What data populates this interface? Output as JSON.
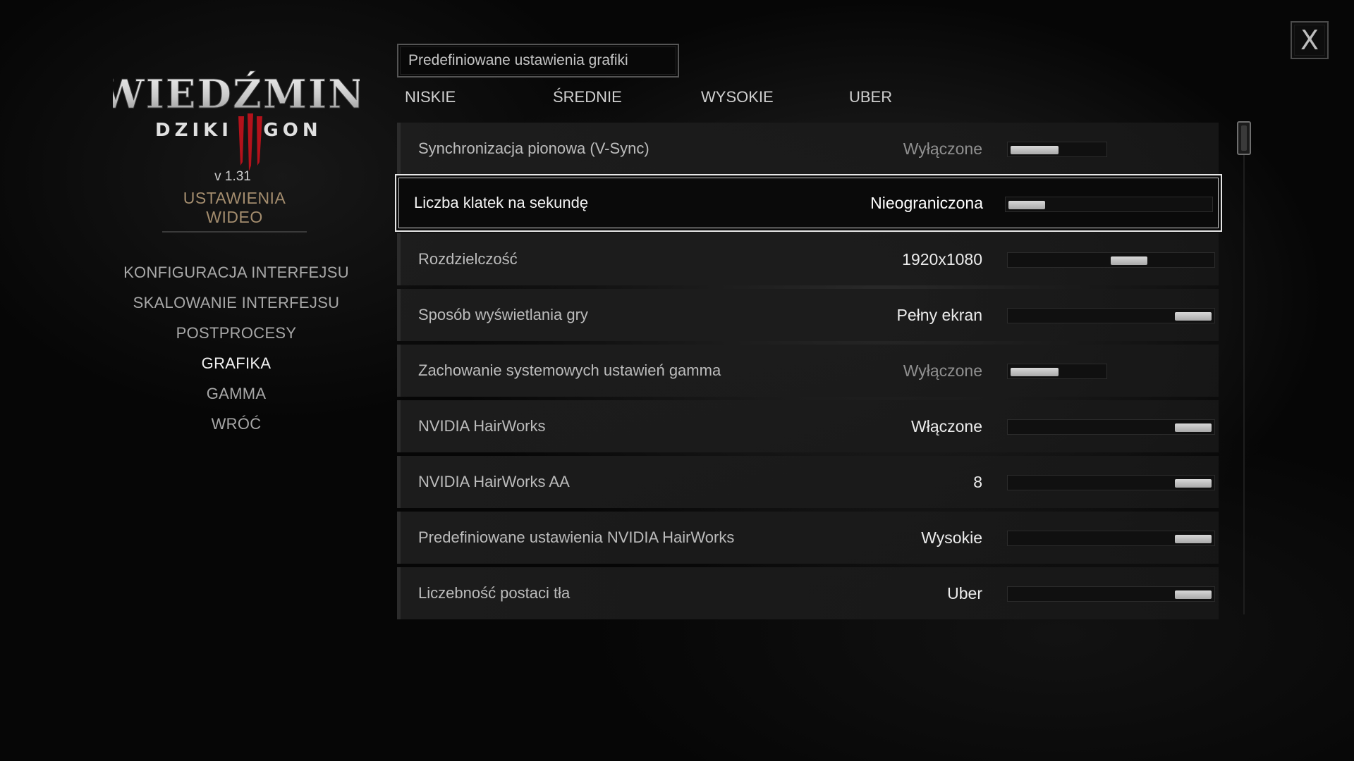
{
  "close_button": {
    "label": "X"
  },
  "logo": {
    "title": "WIEDŹMIN",
    "subtitle_left": "DZIKI",
    "subtitle_right": "GON",
    "numeral": "III"
  },
  "sidebar": {
    "version": "v 1.31",
    "section_title": "USTAWIENIA WIDEO",
    "items": [
      {
        "label": "KONFIGURACJA INTERFEJSU",
        "active": false
      },
      {
        "label": "SKALOWANIE INTERFEJSU",
        "active": false
      },
      {
        "label": "POSTPROCESY",
        "active": false
      },
      {
        "label": "GRAFIKA",
        "active": true
      },
      {
        "label": "GAMMA",
        "active": false
      },
      {
        "label": "WRÓĆ",
        "active": false
      }
    ]
  },
  "presets": {
    "title": "Predefiniowane ustawienia grafiki",
    "options": [
      "NISKIE",
      "ŚREDNIE",
      "WYSOKIE",
      "UBER"
    ]
  },
  "settings": [
    {
      "label": "Synchronizacja pionowa (V-Sync)",
      "value": "Wyłączone",
      "slider_type": "toggle",
      "level": 0.0,
      "dim": true
    },
    {
      "label": "Liczba klatek na sekundę",
      "value": "Nieograniczona",
      "slider_type": "range",
      "level": 0.0,
      "selected": true
    },
    {
      "label": "Rozdzielczość",
      "value": "1920x1080",
      "slider_type": "range",
      "level": 0.55
    },
    {
      "label": "Sposób wyświetlania gry",
      "value": "Pełny ekran",
      "slider_type": "range",
      "level": 1.0
    },
    {
      "label": "Zachowanie systemowych ustawień gamma",
      "value": "Wyłączone",
      "slider_type": "toggle",
      "level": 0.0,
      "dim": true
    },
    {
      "label": "NVIDIA HairWorks",
      "value": "Włączone",
      "slider_type": "range",
      "level": 1.0
    },
    {
      "label": "NVIDIA HairWorks AA",
      "value": "8",
      "slider_type": "range",
      "level": 1.0
    },
    {
      "label": "Predefiniowane ustawienia NVIDIA HairWorks",
      "value": "Wysokie",
      "slider_type": "range",
      "level": 1.0
    },
    {
      "label": "Liczebność postaci tła",
      "value": "Uber",
      "slider_type": "range",
      "level": 1.0
    }
  ],
  "colors": {
    "accent_title": "#a48d6e",
    "logo_red": "#b3121b",
    "text_primary": "#ececec",
    "text_dim": "#8f8f8f"
  }
}
